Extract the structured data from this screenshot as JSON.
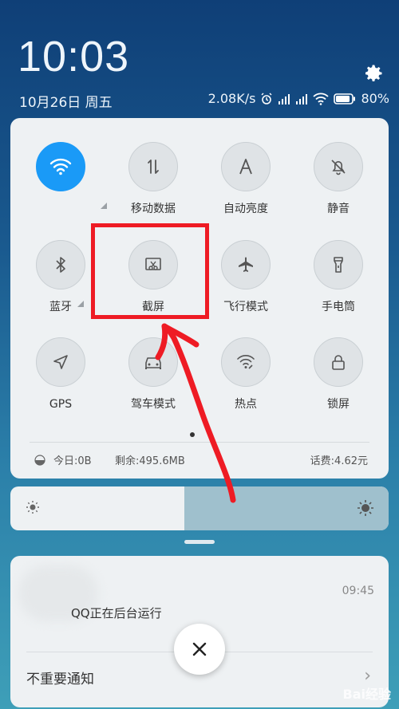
{
  "status": {
    "time": "10:03",
    "date": "10月26日 周五",
    "speed": "2.08K/s",
    "battery": "80%"
  },
  "tiles": [
    {
      "label": "",
      "icon": "wifi-icon",
      "on": true
    },
    {
      "label": "移动数据",
      "icon": "mobile-data-icon",
      "on": false
    },
    {
      "label": "自动亮度",
      "icon": "auto-brightness-icon",
      "on": false
    },
    {
      "label": "静音",
      "icon": "mute-icon",
      "on": false
    },
    {
      "label": "蓝牙",
      "icon": "bluetooth-icon",
      "on": false
    },
    {
      "label": "截屏",
      "icon": "screenshot-icon",
      "on": false
    },
    {
      "label": "飞行模式",
      "icon": "airplane-icon",
      "on": false
    },
    {
      "label": "手电筒",
      "icon": "flashlight-icon",
      "on": false
    },
    {
      "label": "GPS",
      "icon": "gps-icon",
      "on": false
    },
    {
      "label": "驾车模式",
      "icon": "car-icon",
      "on": false
    },
    {
      "label": "热点",
      "icon": "hotspot-icon",
      "on": false
    },
    {
      "label": "锁屏",
      "icon": "lock-icon",
      "on": false
    }
  ],
  "usage": {
    "today": "今日:0B",
    "remaining": "剩余:495.6MB",
    "balance": "话费:4.62元"
  },
  "brightness": {
    "level": 0.46
  },
  "notification": {
    "time": "09:45",
    "message": "QQ正在后台运行",
    "unimportant": "不重要通知"
  },
  "watermark": "Bai经验",
  "colors": {
    "accent": "#1a9af7",
    "annotation": "#ee1b24"
  }
}
